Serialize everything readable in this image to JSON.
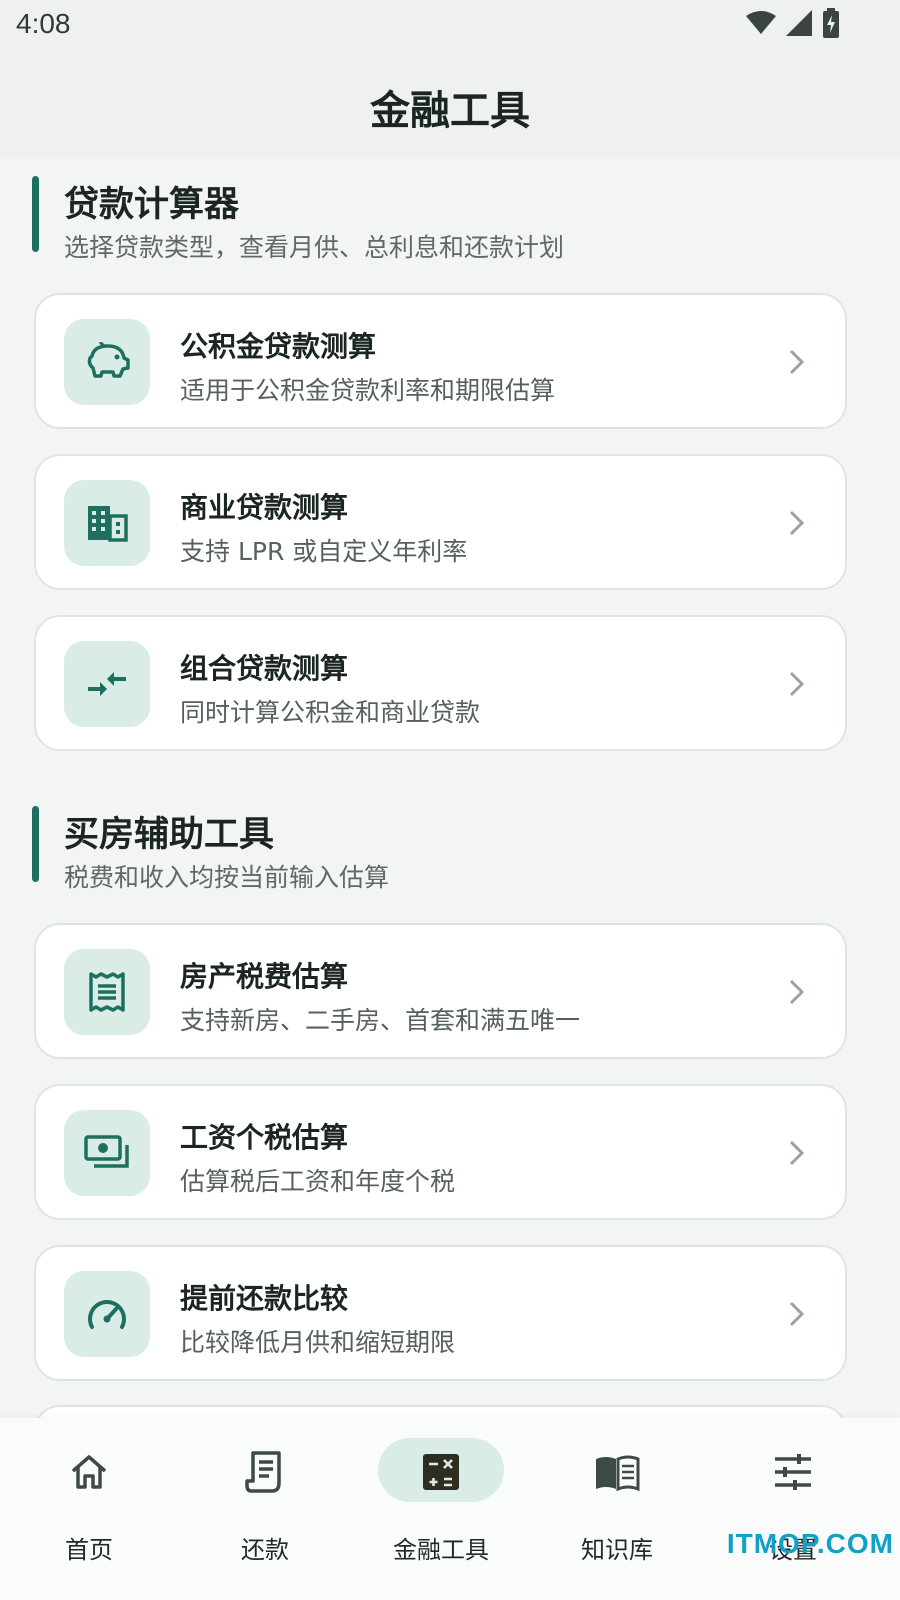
{
  "status": {
    "time": "4:08"
  },
  "header": {
    "title": "金融工具"
  },
  "loan_section": {
    "title": "贷款计算器",
    "subtitle": "选择贷款类型，查看月供、总利息和还款计划",
    "cards": [
      {
        "title": "公积金贷款测算",
        "subtitle": "适用于公积金贷款利率和期限估算",
        "icon": "piggy-bank-icon"
      },
      {
        "title": "商业贷款测算",
        "subtitle": "支持 LPR 或自定义年利率",
        "icon": "building-icon"
      },
      {
        "title": "组合贷款测算",
        "subtitle": "同时计算公积金和商业贷款",
        "icon": "combine-arrows-icon"
      }
    ]
  },
  "housing_section": {
    "title": "买房辅助工具",
    "subtitle": "税费和收入均按当前输入估算",
    "cards": [
      {
        "title": "房产税费估算",
        "subtitle": "支持新房、二手房、首套和满五唯一",
        "icon": "receipt-icon"
      },
      {
        "title": "工资个税估算",
        "subtitle": "估算税后工资和年度个税",
        "icon": "payments-icon"
      },
      {
        "title": "提前还款比较",
        "subtitle": "比较降低月供和缩短期限",
        "icon": "speedometer-icon"
      }
    ]
  },
  "nav": {
    "items": [
      {
        "label": "首页",
        "icon": "home-icon"
      },
      {
        "label": "还款",
        "icon": "receipt-long-icon"
      },
      {
        "label": "金融工具",
        "icon": "calculator-icon",
        "selected": true
      },
      {
        "label": "知识库",
        "icon": "book-icon"
      },
      {
        "label": "设置",
        "icon": "tune-icon"
      }
    ]
  },
  "watermark": "ITMOP.COM",
  "colors": {
    "accent": "#1e6f60",
    "icon_bg": "#d9ece6",
    "background": "#f2f5f3"
  }
}
